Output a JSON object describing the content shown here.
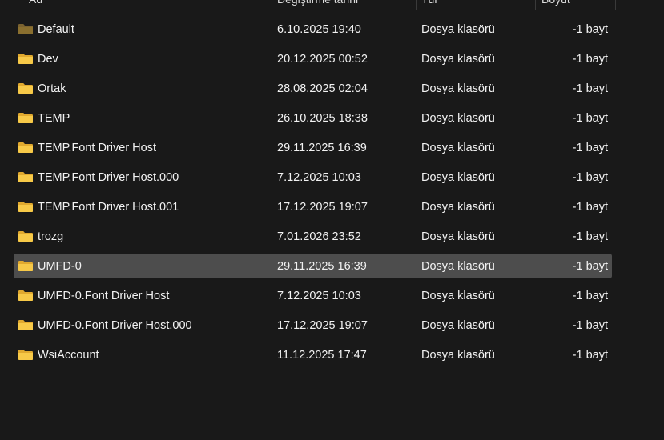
{
  "header": {
    "name_label": "Ad",
    "date_label": "Değiştirme tarihi",
    "type_label": "Tür",
    "size_label": "Boyut"
  },
  "colors": {
    "background": "#191919",
    "selected_row": "#4d4d4d",
    "folder_yellow": "#f7c948",
    "folder_dim": "#8a6f2f"
  },
  "files": [
    {
      "name": "Default",
      "date": "6.10.2025 19:40",
      "type": "Dosya klasörü",
      "size": "-1 bayt",
      "icon": "folder-dim-icon"
    },
    {
      "name": "Dev",
      "date": "20.12.2025 00:52",
      "type": "Dosya klasörü",
      "size": "-1 bayt",
      "icon": "folder-icon"
    },
    {
      "name": "Ortak",
      "date": "28.08.2025 02:04",
      "type": "Dosya klasörü",
      "size": "-1 bayt",
      "icon": "folder-icon"
    },
    {
      "name": "TEMP",
      "date": "26.10.2025 18:38",
      "type": "Dosya klasörü",
      "size": "-1 bayt",
      "icon": "folder-icon"
    },
    {
      "name": "TEMP.Font Driver Host",
      "date": "29.11.2025 16:39",
      "type": "Dosya klasörü",
      "size": "-1 bayt",
      "icon": "folder-icon"
    },
    {
      "name": "TEMP.Font Driver Host.000",
      "date": "7.12.2025 10:03",
      "type": "Dosya klasörü",
      "size": "-1 bayt",
      "icon": "folder-icon"
    },
    {
      "name": "TEMP.Font Driver Host.001",
      "date": "17.12.2025 19:07",
      "type": "Dosya klasörü",
      "size": "-1 bayt",
      "icon": "folder-icon"
    },
    {
      "name": "trozg",
      "date": "7.01.2026 23:52",
      "type": "Dosya klasörü",
      "size": "-1 bayt",
      "icon": "folder-icon"
    },
    {
      "name": "UMFD-0",
      "date": "29.11.2025 16:39",
      "type": "Dosya klasörü",
      "size": "-1 bayt",
      "icon": "folder-icon",
      "selected": true
    },
    {
      "name": "UMFD-0.Font Driver Host",
      "date": "7.12.2025 10:03",
      "type": "Dosya klasörü",
      "size": "-1 bayt",
      "icon": "folder-icon"
    },
    {
      "name": "UMFD-0.Font Driver Host.000",
      "date": "17.12.2025 19:07",
      "type": "Dosya klasörü",
      "size": "-1 bayt",
      "icon": "folder-icon"
    },
    {
      "name": "WsiAccount",
      "date": "11.12.2025 17:47",
      "type": "Dosya klasörü",
      "size": "-1 bayt",
      "icon": "folder-icon"
    }
  ]
}
